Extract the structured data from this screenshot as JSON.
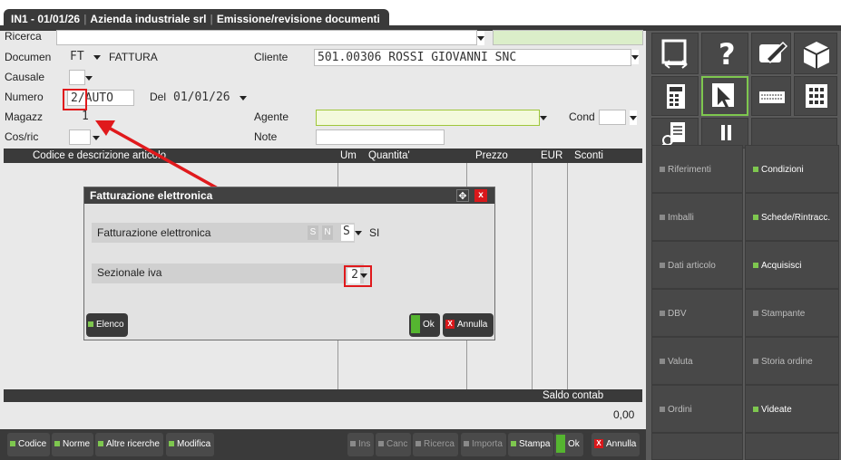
{
  "window": {
    "tab_code": "IN1 - 01/01/26",
    "tab_company": "Azienda industriale srl",
    "tab_function": "Emissione/revisione documenti"
  },
  "form": {
    "ricerca_label": "Ricerca",
    "documen_label": "Documen",
    "documen_code": "FT",
    "documen_desc": "FATTURA",
    "cliente_label": "Cliente",
    "cliente_value": "501.00306 ROSSI GIOVANNI SNC",
    "causale_label": "Causale",
    "numero_label": "Numero",
    "numero_value": "2/AUTO",
    "del_label": "Del",
    "del_value": "01/01/26",
    "magazz_label": "Magazz",
    "magazz_value": "1",
    "agente_label": "Agente",
    "cond_label": "Cond",
    "cosric_label": "Cos/ric",
    "note_label": "Note"
  },
  "grid": {
    "columns": [
      "Codice e descrizione articolo",
      "Um",
      "Quantita'",
      "Prezzo",
      "EUR",
      "Sconti"
    ],
    "saldo_label": "Saldo contab",
    "saldo_value": "0,00"
  },
  "dialog": {
    "title": "Fatturazione elettronica",
    "row1_label": "Fatturazione elettronica",
    "row1_opt_s": "S",
    "row1_opt_n": "N",
    "row1_value": "S",
    "row1_desc": "SI",
    "row2_label": "Sezionale iva",
    "row2_value": "2",
    "elenco_button": "Elenco",
    "ok_button": "Ok",
    "annulla_button": "Annulla"
  },
  "bottom_buttons": {
    "codice": "Codice",
    "norme": "Norme",
    "altre_ricerche": "Altre ricerche",
    "modifica": "Modifica",
    "ins": "Ins",
    "canc": "Canc",
    "ricerca": "Ricerca",
    "importa": "Importa",
    "stampa": "Stampa",
    "ok": "Ok",
    "annulla": "Annulla"
  },
  "right_panel": {
    "buttons": [
      "Riferimenti",
      "Condizioni",
      "Imballi",
      "Schede/Rintracc.",
      "Dati articolo",
      "Acquisisci",
      "DBV",
      "Stampante",
      "Valuta",
      "Storia ordine",
      "Ordini",
      "Videate"
    ],
    "enabled": [
      false,
      true,
      false,
      true,
      false,
      true,
      false,
      false,
      false,
      false,
      false,
      true
    ]
  },
  "colors": {
    "accent_green": "#7ec74f",
    "annotation_red": "#e0191c",
    "close_red": "#d9181b",
    "dark_band": "#3a3a3a"
  },
  "icons": [
    "resize-icon",
    "help-icon",
    "edit-icon",
    "cube-icon",
    "calculator-icon",
    "pointer-icon",
    "keyboard-icon",
    "grid-icon",
    "document-search-icon",
    "pause-icon"
  ]
}
